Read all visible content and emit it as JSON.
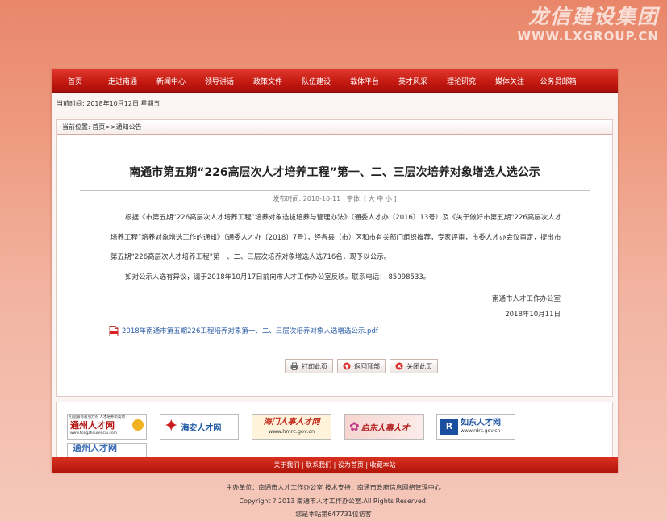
{
  "watermark": {
    "title": "龙信建设集团",
    "url": "WWW.LXGROUP.CN"
  },
  "nav": {
    "items": [
      "首页",
      "走进南通",
      "新闻中心",
      "领导讲话",
      "政策文件",
      "队伍建设",
      "载体平台",
      "英才风采",
      "理论研究",
      "媒体关注",
      "公务员邮箱"
    ]
  },
  "date_line": "当前时间: 2018年10月12日 星期五",
  "breadcrumb": {
    "prefix": "当前位置:",
    "home": "首页",
    "sep": ">>",
    "current": "通知公告"
  },
  "article": {
    "title": "南通市第五期“226高层次人才培养工程”第一、二、三层次培养对象增选人选公示",
    "meta_publish": "发布时间: 2018-10-11",
    "meta_font_label": "字体:",
    "meta_font_sizes": "[ 大 中 小 ]",
    "para1": "根据《市第五期“226高层次人才培养工程”培养对象选拔培养与管理办法》（通委人才办〔2016〕13号）及《关于做好市第五期“226高层次人才培养工程”培养对象增选工作的通知》（通委人才办〔2018〕7号），经各县（市）区和市有关部门组织推荐，专家评审，市委人才办会议审定，提出市第五期“226高层次人才培养工程”第一、二、三层次培养对象增选人选716名，现予以公示。",
    "para2": "如对公示人选有异议，请于2018年10月17日前向市人才工作办公室反映。联系电话：  85098533。",
    "signature_org": "南通市人才工作办公室",
    "signature_date": "2018年10月11日",
    "attachment": "2018年南通市第五期226工程培养对象第一、二、三层次培养对象人选增选公示.pdf"
  },
  "buttons": {
    "print": "打印此页",
    "top": "返回顶部",
    "close": "关闭此页"
  },
  "links": {
    "tongzhou_tag": "打造最有吸引力的 人才培养新高地",
    "tongzhou_name": "通州人才网",
    "tongzhou_url": "www.tongzhourencai.com",
    "haian": "海安人才网",
    "haimen_name": "海门人事人才网",
    "haimen_url": "www.hmrc.gov.cn",
    "qidong": "启东人事人才",
    "rudong_name": "如东人才网",
    "rudong_url": "www.rdrc.gov.cn"
  },
  "footer_links": [
    "关于我们",
    "联系我们",
    "设为首页",
    "收藏本站"
  ],
  "footer": {
    "sponsor": "主办单位：南通市人才工作办公室 技术支持：南通市政府信息网络管理中心",
    "copyright": "Copyright ?  2013 南通市人才工作办公室.All Rights Reserved.",
    "visitors": "您是本站第647731位访客"
  },
  "colors": {
    "nav_red": "#c41a12",
    "link_blue": "#2b5ea6"
  }
}
